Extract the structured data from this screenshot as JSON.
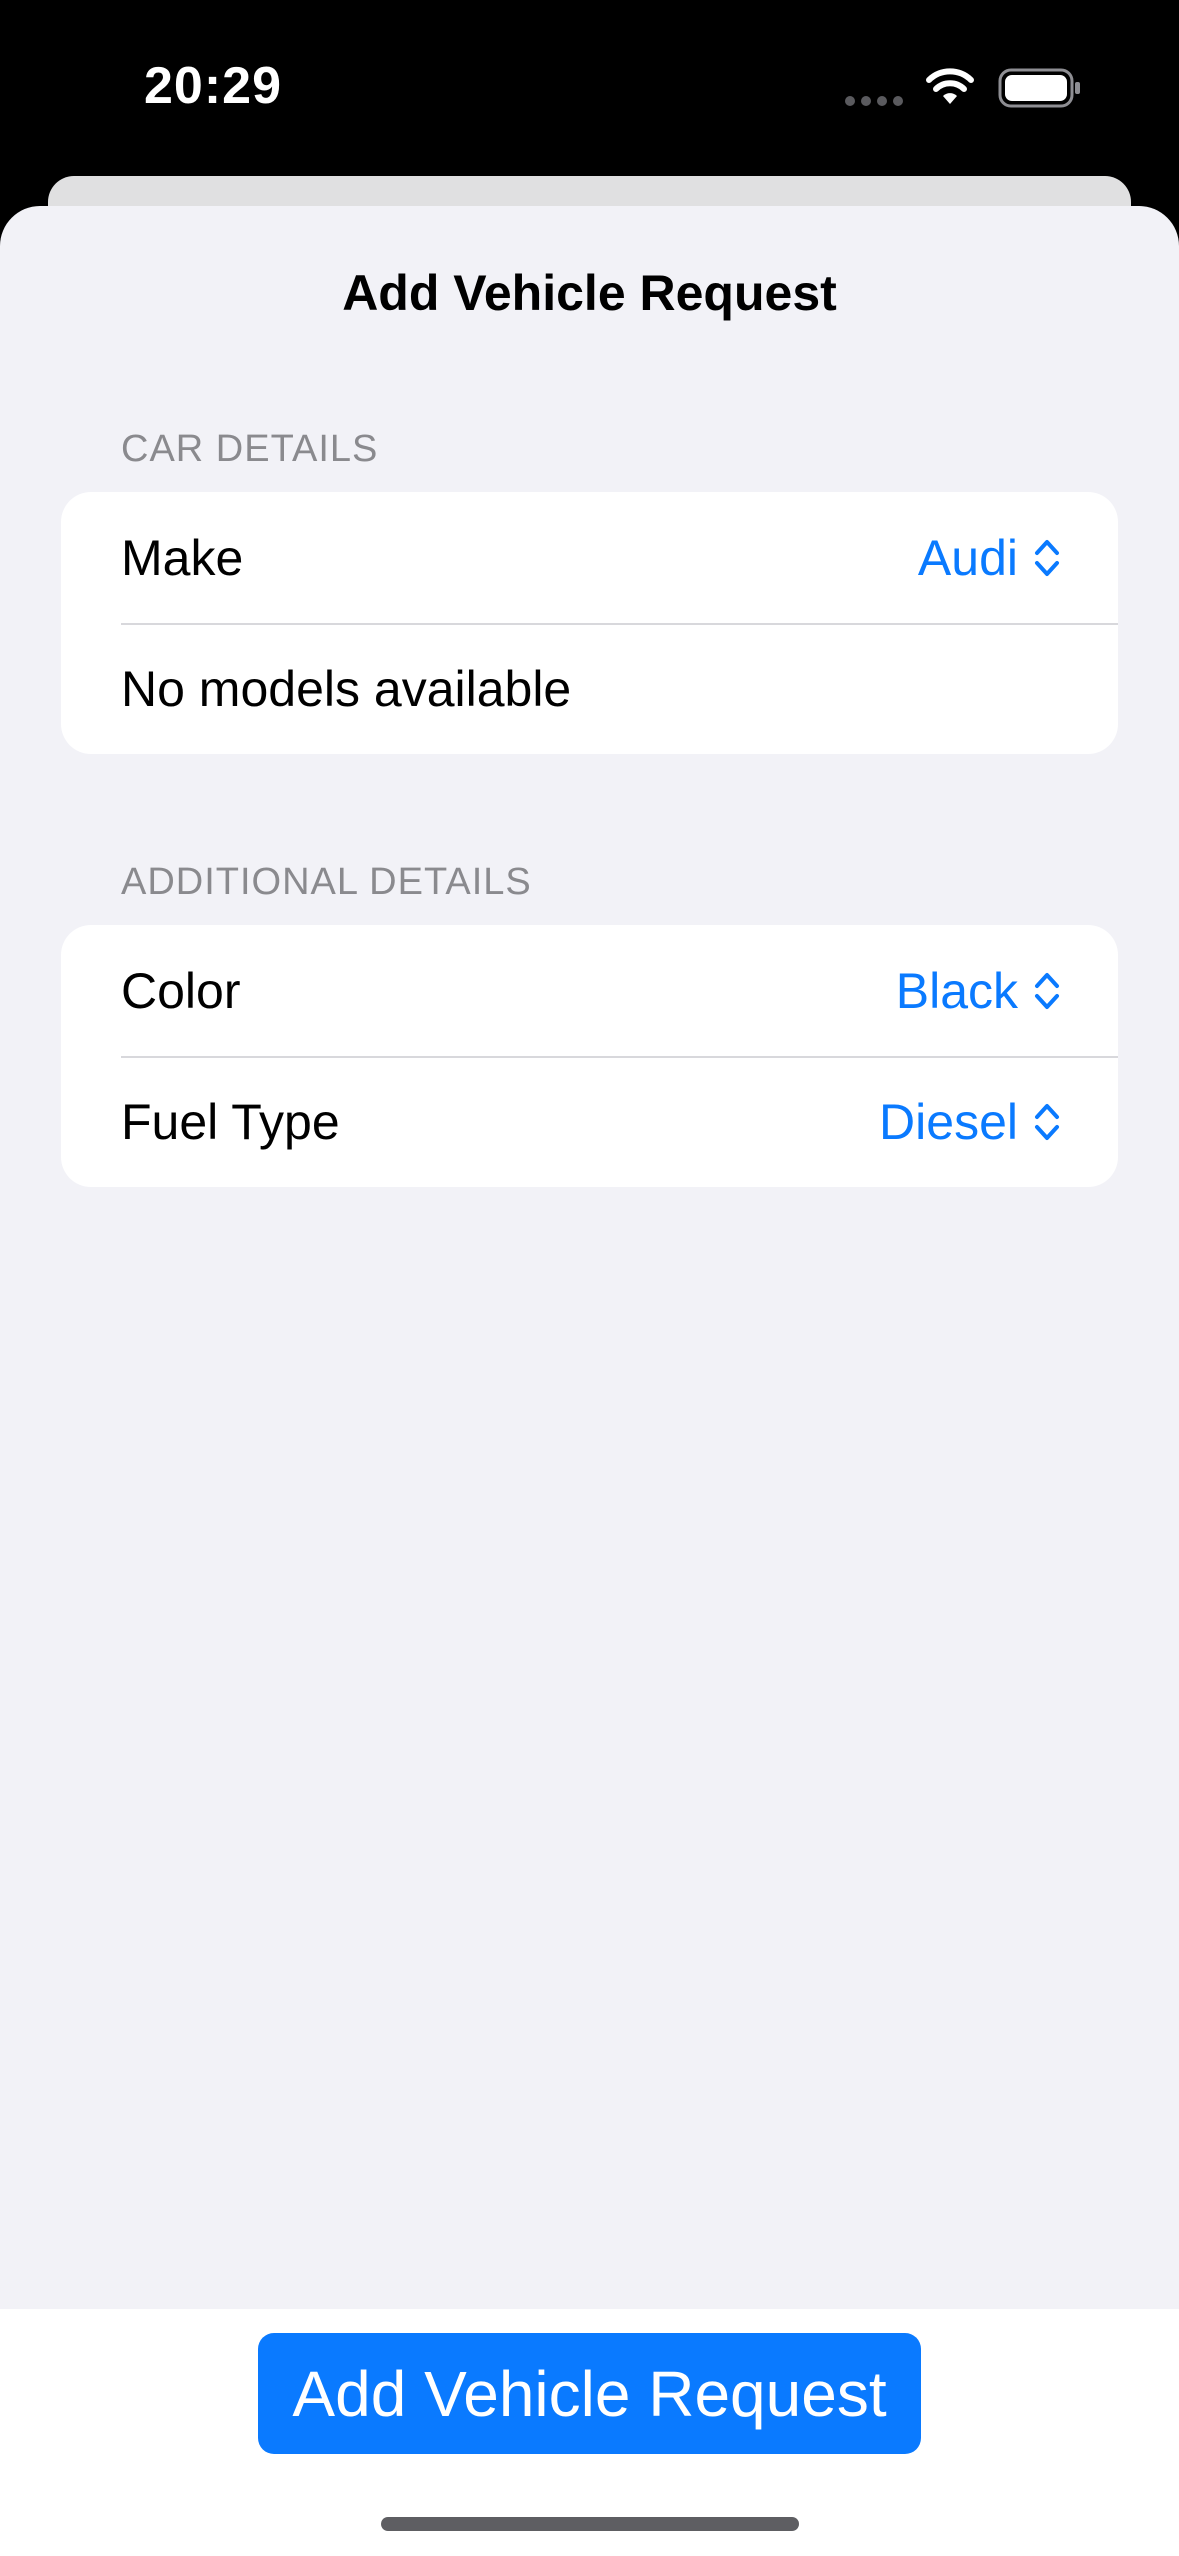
{
  "status_bar": {
    "time": "20:29",
    "icons": [
      "signal-dots-icon",
      "wifi-icon",
      "battery-icon"
    ]
  },
  "sheet": {
    "title": "Add Vehicle Request"
  },
  "sections": {
    "car_details": {
      "header": "CAR DETAILS",
      "make_label": "Make",
      "make_value": "Audi",
      "model_message": "No models available"
    },
    "additional_details": {
      "header": "ADDITIONAL DETAILS",
      "color_label": "Color",
      "color_value": "Black",
      "fuel_label": "Fuel Type",
      "fuel_value": "Diesel"
    }
  },
  "footer": {
    "button_label": "Add Vehicle Request"
  },
  "colors": {
    "accent": "#0a7aff",
    "sheet_background": "#f2f2f7",
    "secondary_text": "#8a8a8e"
  }
}
